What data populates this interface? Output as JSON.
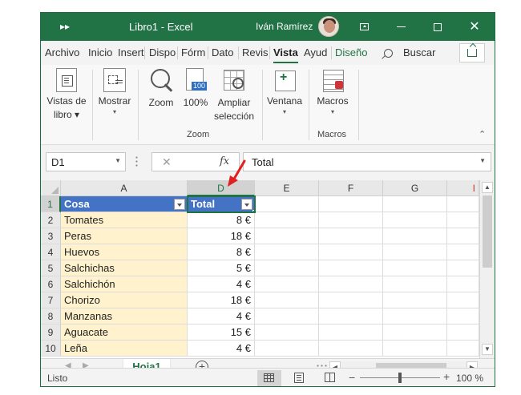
{
  "titlebar": {
    "quick_access": "▸▸",
    "title": "Libro1  -  Excel",
    "user": "Iván Ramírez"
  },
  "tabs": {
    "items": [
      "Archivo",
      "Inicio",
      "Insert",
      "Dispo",
      "Fórm",
      "Dato",
      "Revis",
      "Vista",
      "Ayud",
      "Diseño"
    ],
    "active": "Vista",
    "search_label": "Buscar"
  },
  "ribbon": {
    "workbook_views": {
      "line1": "Vistas de",
      "line2": "libro"
    },
    "show": {
      "label": "Mostrar"
    },
    "zoom": {
      "label": "Zoom"
    },
    "zoom100": {
      "label": "100%",
      "badge": "100"
    },
    "zoom_selection": {
      "line1": "Ampliar",
      "line2": "selección"
    },
    "window": {
      "label": "Ventana"
    },
    "macros": {
      "label": "Macros"
    },
    "group_zoom": "Zoom",
    "group_macros": "Macros"
  },
  "formula_bar": {
    "name_box": "D1",
    "cancel": "✕",
    "fx": "fx",
    "value": "Total"
  },
  "grid": {
    "columns": [
      "A",
      "D",
      "E",
      "F",
      "G",
      "I"
    ],
    "rows": [
      "1",
      "2",
      "3",
      "4",
      "5",
      "6",
      "7",
      "8",
      "9",
      "10"
    ],
    "header": {
      "a": "Cosa",
      "d": "Total"
    },
    "data": [
      {
        "a": "Tomates",
        "d": "8 €"
      },
      {
        "a": "Peras",
        "d": "18 €"
      },
      {
        "a": "Huevos",
        "d": "8 €"
      },
      {
        "a": "Salchichas",
        "d": "5 €"
      },
      {
        "a": "Salchichón",
        "d": "4 €"
      },
      {
        "a": "Chorizo",
        "d": "18 €"
      },
      {
        "a": "Manzanas",
        "d": "4 €"
      },
      {
        "a": "Aguacate",
        "d": "15 €"
      },
      {
        "a": "Leña",
        "d": "4 €"
      }
    ]
  },
  "sheets": {
    "active": "Hoja1",
    "add": "+"
  },
  "statusbar": {
    "ready": "Listo",
    "zoom": "100 %",
    "minus": "−",
    "plus": "+"
  },
  "colors": {
    "excel_green": "#217346",
    "table_header": "#4472c4",
    "band": "#fff2cc",
    "arrow": "#e02020"
  }
}
